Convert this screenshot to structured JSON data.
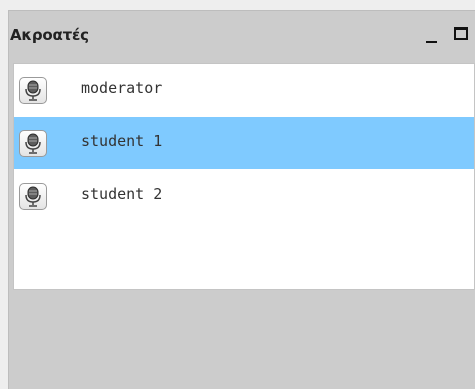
{
  "panel": {
    "title": "Ακροατές",
    "controls": {
      "minimize_icon": "minimize-icon",
      "maximize_icon": "maximize-icon"
    }
  },
  "listeners": [
    {
      "name": "moderator",
      "icon": "microphone-icon",
      "selected": false
    },
    {
      "name": "student 1",
      "icon": "microphone-icon",
      "selected": true
    },
    {
      "name": "student 2",
      "icon": "microphone-icon",
      "selected": false
    }
  ],
  "colors": {
    "selection": "#7fcaff",
    "panel_background": "#cccccc",
    "list_background": "#ffffff"
  }
}
